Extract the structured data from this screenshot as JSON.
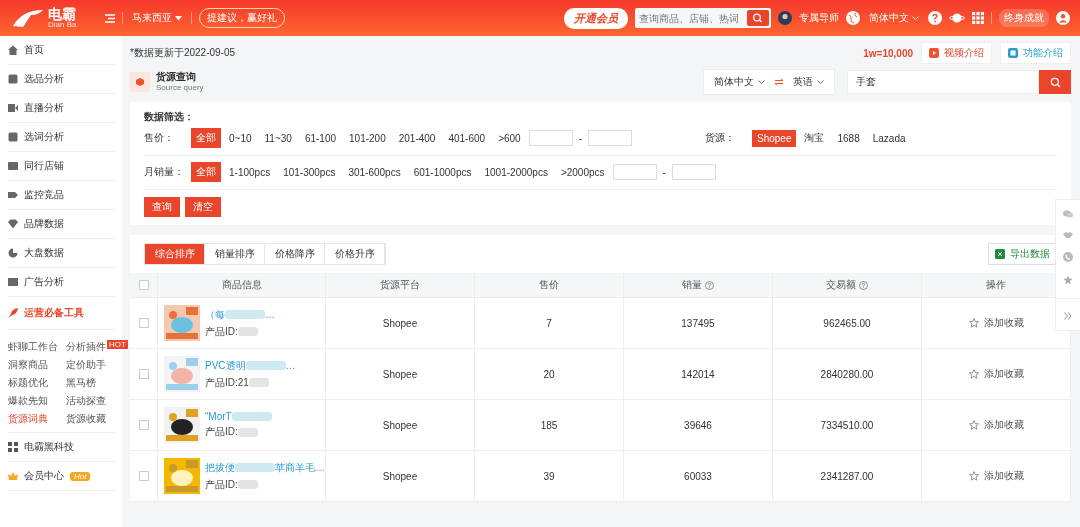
{
  "header": {
    "logo": {
      "name": "电霸",
      "sub": "Dian Ba"
    },
    "region": "马来西亚",
    "suggest": "提建议，赢好礼",
    "vip": "开通会员",
    "search": {
      "placeholder": "查询商品、店铺、热词"
    },
    "mentor": "专属导师",
    "language": "简体中文",
    "achievement": "终身成就"
  },
  "sidebar": {
    "items": [
      {
        "label": "首页"
      },
      {
        "label": "选品分析"
      },
      {
        "label": "直播分析"
      },
      {
        "label": "选词分析"
      },
      {
        "label": "同行店铺"
      },
      {
        "label": "监控竞品"
      },
      {
        "label": "品牌数据"
      },
      {
        "label": "大盘数据"
      },
      {
        "label": "广告分析"
      }
    ],
    "tools_title": "运营必备工具",
    "tools": [
      {
        "label": "虾聊工作台",
        "selected": false
      },
      {
        "label": "分析插件",
        "selected": false,
        "badge": "HOT"
      },
      {
        "label": "洞察商品",
        "selected": false
      },
      {
        "label": "定价助手",
        "selected": false
      },
      {
        "label": "标题优化",
        "selected": false
      },
      {
        "label": "黑马榜",
        "selected": false
      },
      {
        "label": "爆款先知",
        "selected": false
      },
      {
        "label": "活动探查",
        "selected": false
      },
      {
        "label": "货源词典",
        "selected": true
      },
      {
        "label": "货源收藏",
        "selected": false
      }
    ],
    "extra": [
      {
        "label": "电霸黑科技"
      },
      {
        "label": "会员中心",
        "badge": "Hot"
      }
    ]
  },
  "top": {
    "update_note": "*数据更新于2022-09-05",
    "unit": "1w=10,000",
    "buttons": [
      "视频介绍",
      "功能介绍"
    ]
  },
  "page": {
    "title": "货源查询",
    "subtitle": "Source query"
  },
  "translate": {
    "from": "简体中文",
    "to": "英语",
    "query": "手套"
  },
  "filter": {
    "title": "数据筛选：",
    "price": {
      "label": "售价：",
      "options": [
        {
          "label": "全部",
          "selected": true
        },
        {
          "label": "0~10",
          "selected": false
        },
        {
          "label": "11~30",
          "selected": false
        },
        {
          "label": "61-100",
          "selected": false
        },
        {
          "label": "101-200",
          "selected": false
        },
        {
          "label": "201-400",
          "selected": false
        },
        {
          "label": "401-600",
          "selected": false
        },
        {
          "label": ">600",
          "selected": false
        }
      ],
      "range_separator": "-"
    },
    "source": {
      "label": "货源：",
      "options": [
        {
          "label": "Shopee",
          "selected": true
        },
        {
          "label": "淘宝",
          "selected": false
        },
        {
          "label": "1688",
          "selected": false
        },
        {
          "label": "Lazada",
          "selected": false
        }
      ]
    },
    "monthly_sales": {
      "label": "月销量：",
      "options": [
        {
          "label": "全部",
          "selected": true
        },
        {
          "label": "1-100pcs",
          "selected": false
        },
        {
          "label": "101-300pcs",
          "selected": false
        },
        {
          "label": "301-600pcs",
          "selected": false
        },
        {
          "label": "601-1000pcs",
          "selected": false
        },
        {
          "label": "1001-2000pcs",
          "selected": false
        },
        {
          "label": ">2000pcs",
          "selected": false
        }
      ],
      "range_separator": "-"
    },
    "buttons": [
      "查询",
      "清空"
    ]
  },
  "sort_tabs": [
    {
      "label": "综合排序",
      "selected": true
    },
    {
      "label": "销量排序",
      "selected": false
    },
    {
      "label": "价格降序",
      "selected": false
    },
    {
      "label": "价格升序",
      "selected": false
    }
  ],
  "export": "导出数据",
  "table": {
    "all_checked": false,
    "columns": [
      {
        "label": "商品信息",
        "help": false
      },
      {
        "label": "货源平台",
        "help": false
      },
      {
        "label": "售价",
        "help": false
      },
      {
        "label": "销量",
        "help": true
      },
      {
        "label": "交易额",
        "help": true
      },
      {
        "label": "操作",
        "help": false
      }
    ],
    "rows": [
      {
        "checked": false,
        "title": "（每",
        "suffix": "…",
        "id": "产品ID:",
        "platform": "Shopee",
        "price": "7",
        "sales": "137495",
        "amount": "962465.00",
        "action": "添加收藏"
      },
      {
        "checked": false,
        "title": "PVC透明",
        "suffix": "…",
        "id": "产品ID:21",
        "platform": "Shopee",
        "price": "20",
        "sales": "142014",
        "amount": "2840280.00",
        "action": "添加收藏"
      },
      {
        "checked": false,
        "title": "“MorT",
        "id": "产品ID:",
        "platform": "Shopee",
        "price": "185",
        "sales": "39646",
        "amount": "7334510.00",
        "action": "添加收藏"
      },
      {
        "checked": false,
        "title": "把拔便",
        "suffix": "苹商羊毛…",
        "id": "产品ID:",
        "platform": "Shopee",
        "price": "39",
        "sales": "60033",
        "amount": "2341287.00",
        "action": "添加收藏"
      }
    ]
  }
}
